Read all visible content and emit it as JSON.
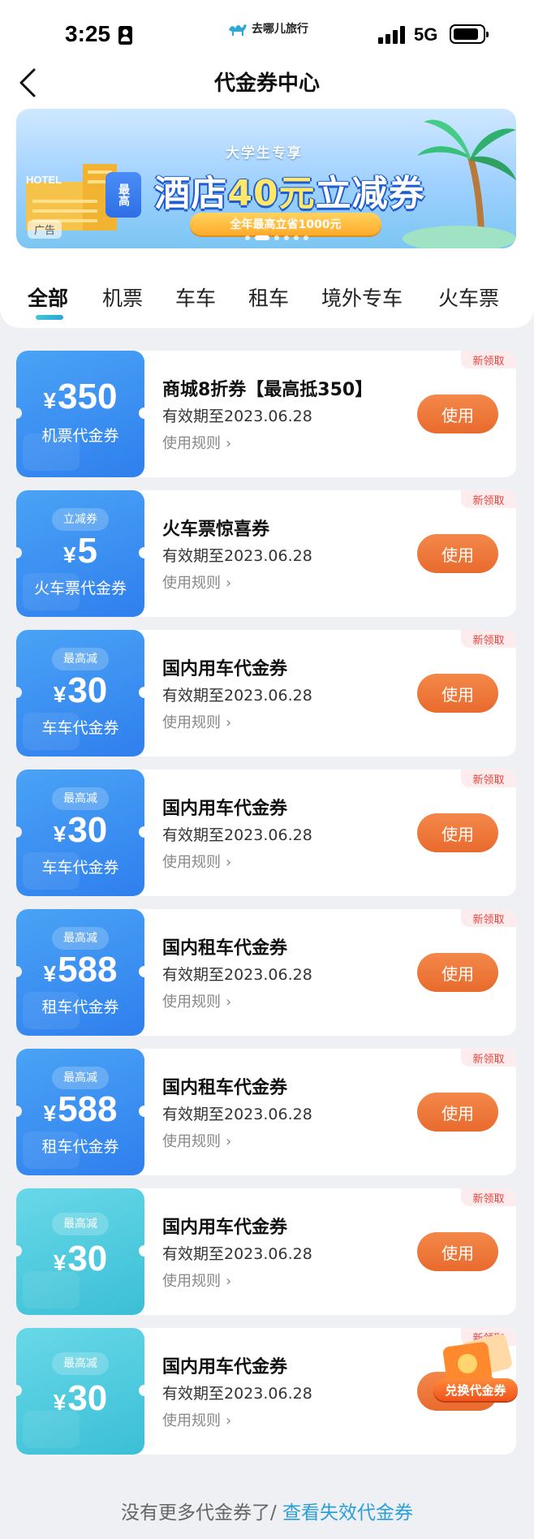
{
  "status_bar": {
    "time": "3:25",
    "brand": "去哪儿旅行",
    "network": "5G"
  },
  "nav": {
    "title": "代金券中心"
  },
  "banner": {
    "subtitle": "大学生专享",
    "badge": "最高",
    "title_pre": "酒店",
    "title_amount": "40元",
    "title_post": "立减券",
    "pill": "全年最高立省1000元",
    "hotel_label": "HOTEL",
    "ad_label": "广告"
  },
  "tabs": [
    {
      "label": "全部",
      "active": true
    },
    {
      "label": "机票"
    },
    {
      "label": "车车"
    },
    {
      "label": "租车"
    },
    {
      "label": "境外专车"
    },
    {
      "label": "火车票"
    }
  ],
  "coupons": [
    {
      "theme": "blue",
      "tag": "",
      "currency": "¥",
      "amount": "350",
      "category": "机票代金券",
      "title": "商城8折券【最高抵350】",
      "validity": "有效期至2023.06.28",
      "rules": "使用规则",
      "action": "使用",
      "badge": "新领取"
    },
    {
      "theme": "blue",
      "tag": "立减券",
      "currency": "¥",
      "amount": "5",
      "category": "火车票代金券",
      "title": "火车票惊喜券",
      "validity": "有效期至2023.06.28",
      "rules": "使用规则",
      "action": "使用",
      "badge": "新领取"
    },
    {
      "theme": "blue",
      "tag": "最高减",
      "currency": "¥",
      "amount": "30",
      "category": "车车代金券",
      "title": "国内用车代金券",
      "validity": "有效期至2023.06.28",
      "rules": "使用规则",
      "action": "使用",
      "badge": "新领取"
    },
    {
      "theme": "blue",
      "tag": "最高减",
      "currency": "¥",
      "amount": "30",
      "category": "车车代金券",
      "title": "国内用车代金券",
      "validity": "有效期至2023.06.28",
      "rules": "使用规则",
      "action": "使用",
      "badge": "新领取"
    },
    {
      "theme": "blue",
      "tag": "最高减",
      "currency": "¥",
      "amount": "588",
      "category": "租车代金券",
      "title": "国内租车代金券",
      "validity": "有效期至2023.06.28",
      "rules": "使用规则",
      "action": "使用",
      "badge": "新领取"
    },
    {
      "theme": "blue",
      "tag": "最高减",
      "currency": "¥",
      "amount": "588",
      "category": "租车代金券",
      "title": "国内租车代金券",
      "validity": "有效期至2023.06.28",
      "rules": "使用规则",
      "action": "使用",
      "badge": "新领取"
    },
    {
      "theme": "teal",
      "tag": "最高减",
      "currency": "¥",
      "amount": "30",
      "category": "",
      "title": "国内用车代金券",
      "validity": "有效期至2023.06.28",
      "rules": "使用规则",
      "action": "使用",
      "badge": "新领取"
    },
    {
      "theme": "teal",
      "tag": "最高减",
      "currency": "¥",
      "amount": "30",
      "category": "",
      "title": "国内用车代金券",
      "validity": "有效期至2023.06.28",
      "rules": "使用规则",
      "action": "使用",
      "badge": "新领取"
    }
  ],
  "floating": {
    "exchange_label": "兑换代金券"
  },
  "footer": {
    "text": "没有更多代金券了/",
    "link": "查看失效代金券"
  },
  "colors": {
    "primary_blue": "#2f7fee",
    "teal": "#3bbfd6",
    "use_button": "#e96a2d",
    "link": "#2c9fd8",
    "badge_red": "#e8453c"
  }
}
